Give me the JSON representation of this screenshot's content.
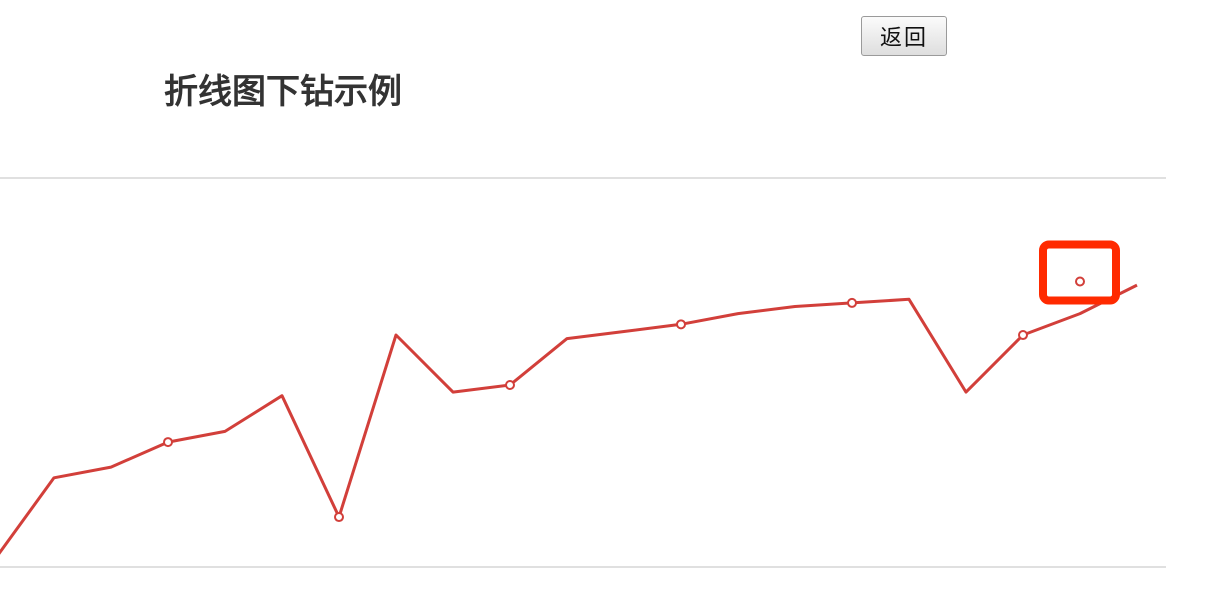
{
  "toolbar": {
    "back_label": "返回"
  },
  "chart_data": {
    "type": "line",
    "title": "折线图下钻示例",
    "xlabel": "",
    "ylabel": "",
    "grid": true,
    "x": [
      0,
      1,
      2,
      3,
      4,
      5,
      6,
      7,
      8,
      9,
      10,
      11,
      12,
      13,
      14,
      15,
      16,
      17,
      18,
      19,
      20
    ],
    "series": [
      {
        "color": "#d23f3a",
        "values": [
          0,
          22,
          25,
          32,
          35,
          45,
          11,
          62,
          46,
          48,
          61,
          63,
          65,
          68,
          70,
          71,
          72,
          46,
          62,
          68,
          76
        ],
        "markers": [
          false,
          false,
          false,
          true,
          false,
          false,
          true,
          false,
          false,
          true,
          false,
          false,
          true,
          false,
          false,
          true,
          false,
          false,
          true,
          false,
          false
        ]
      }
    ],
    "highlight": {
      "x": 19,
      "y": 77,
      "color": "#ff2a00"
    },
    "ylim": [
      -3,
      106
    ]
  }
}
